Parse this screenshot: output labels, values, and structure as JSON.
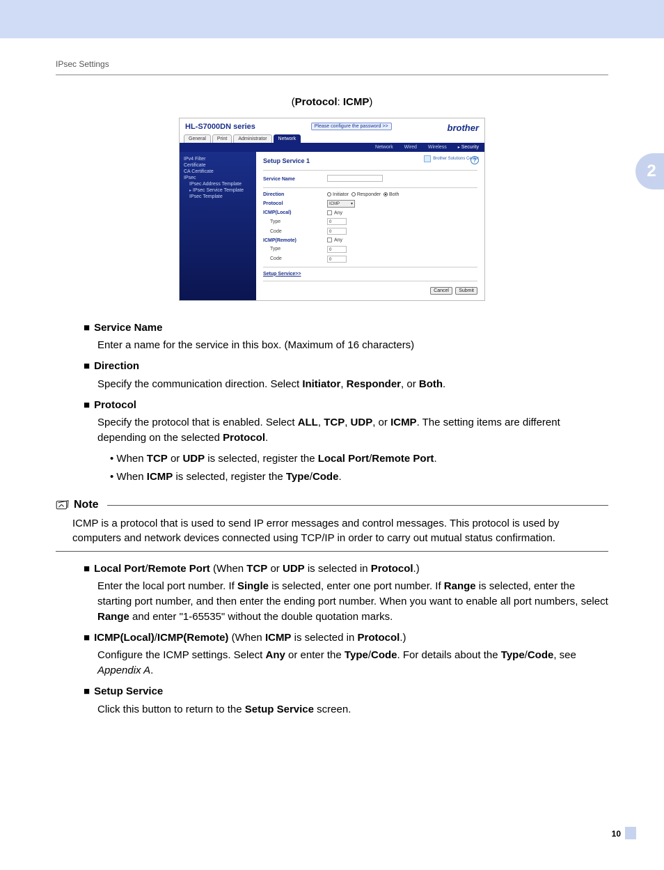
{
  "running_head": "IPsec Settings",
  "chapter_tab": "2",
  "caption": {
    "open": "(",
    "label1": "Protocol",
    "sep": ": ",
    "label2": "ICMP",
    "close": ")"
  },
  "footer": {
    "page": "10"
  },
  "shot": {
    "title": "HL-S7000DN series",
    "pw_prompt": "Please configure the password >>",
    "brand": "brother",
    "solutions_center": "Brother Solutions Center",
    "tabs": [
      "General",
      "Print",
      "Administrator",
      "Network"
    ],
    "active_tab_index": 3,
    "subtabs": [
      "Network",
      "Wired",
      "Wireless",
      "Security"
    ],
    "active_subtab_index": 3,
    "side": [
      "IPv4 Filter",
      "Certificate",
      "CA Certificate",
      "IPsec",
      "IPsec Address Template",
      "IPsec Service Template",
      "IPsec Template"
    ],
    "side_selected_index": 5,
    "heading": "Setup Service 1",
    "rows": {
      "service_name_lbl": "Service Name",
      "direction_lbl": "Direction",
      "direction_opts": [
        "Initiator",
        "Responder",
        "Both"
      ],
      "direction_sel": 2,
      "protocol_lbl": "Protocol",
      "protocol_val": "ICMP",
      "icmp_local_lbl": "ICMP(Local)",
      "icmp_remote_lbl": "ICMP(Remote)",
      "any_lbl": "Any",
      "type_lbl": "Type",
      "code_lbl": "Code",
      "num_val": "0"
    },
    "setup_link": "Setup Service>>",
    "btn_cancel": "Cancel",
    "btn_submit": "Submit"
  },
  "items": {
    "service_name": {
      "title": "Service Name",
      "desc": "Enter a name for the service in this box. (Maximum of 16 characters)"
    },
    "direction": {
      "title": "Direction",
      "desc_a": "Specify the communication direction. Select ",
      "b1": "Initiator",
      "s1": ", ",
      "b2": "Responder",
      "s2": ", or ",
      "b3": "Both",
      "end": "."
    },
    "protocol": {
      "title": "Protocol",
      "desc_a": "Specify the protocol that is enabled. Select ",
      "b1": "ALL",
      "s1": ", ",
      "b2": "TCP",
      "s2": ", ",
      "b3": "UDP",
      "s3": ", or ",
      "b4": "ICMP",
      "desc_b": ". The setting items are different depending on the selected ",
      "b5": "Protocol",
      "end": ".",
      "sub1_a": "When ",
      "sub1_b1": "TCP",
      "sub1_s1": " or ",
      "sub1_b2": "UDP",
      "sub1_c": " is selected, register the ",
      "sub1_b3": "Local Port",
      "sub1_slash": "/",
      "sub1_b4": "Remote Port",
      "sub1_end": ".",
      "sub2_a": "When ",
      "sub2_b1": "ICMP",
      "sub2_c": " is selected, register the ",
      "sub2_b2": "Type",
      "sub2_slash": "/",
      "sub2_b3": "Code",
      "sub2_end": "."
    },
    "local_remote": {
      "b1": "Local Port",
      "slash": "/",
      "b2": "Remote Port",
      "paren_a": " (When ",
      "b3": "TCP",
      "or": " or ",
      "b4": "UDP",
      "paren_b": " is selected in ",
      "b5": "Protocol",
      "paren_c": ".)",
      "desc_a": "Enter the local port number. If ",
      "d_b1": "Single",
      "desc_b": " is selected, enter one port number. If ",
      "d_b2": "Range",
      "desc_c": " is selected, enter the starting port number, and then enter the ending port number. When you want to enable all port numbers, select ",
      "d_b3": "Range",
      "desc_d": " and enter \"1-65535\" without the double quotation marks."
    },
    "icmp_lr": {
      "b1": "ICMP(Local)",
      "slash": "/",
      "b2": "ICMP(Remote)",
      "paren_a": " (When ",
      "b3": "ICMP",
      "paren_b": " is selected in ",
      "b4": "Protocol",
      "paren_c": ".)",
      "desc_a": "Configure the ICMP settings. Select ",
      "d_b1": "Any",
      "desc_b": " or enter the ",
      "d_b2": "Type",
      "d_slash": "/",
      "d_b3": "Code",
      "desc_c": ". For details about the ",
      "d_b4": "Type",
      "d_slash2": "/",
      "d_b5": "Code",
      "desc_d": ", see ",
      "ital": "Appendix A",
      "end": "."
    },
    "setup_service": {
      "title": "Setup Service",
      "desc_a": "Click this button to return to the ",
      "b1": "Setup Service",
      "desc_b": " screen."
    }
  },
  "note": {
    "label": "Note",
    "body": "ICMP is a protocol that is used to send IP error messages and control messages. This protocol is used by computers and network devices connected using TCP/IP in order to carry out mutual status confirmation."
  }
}
